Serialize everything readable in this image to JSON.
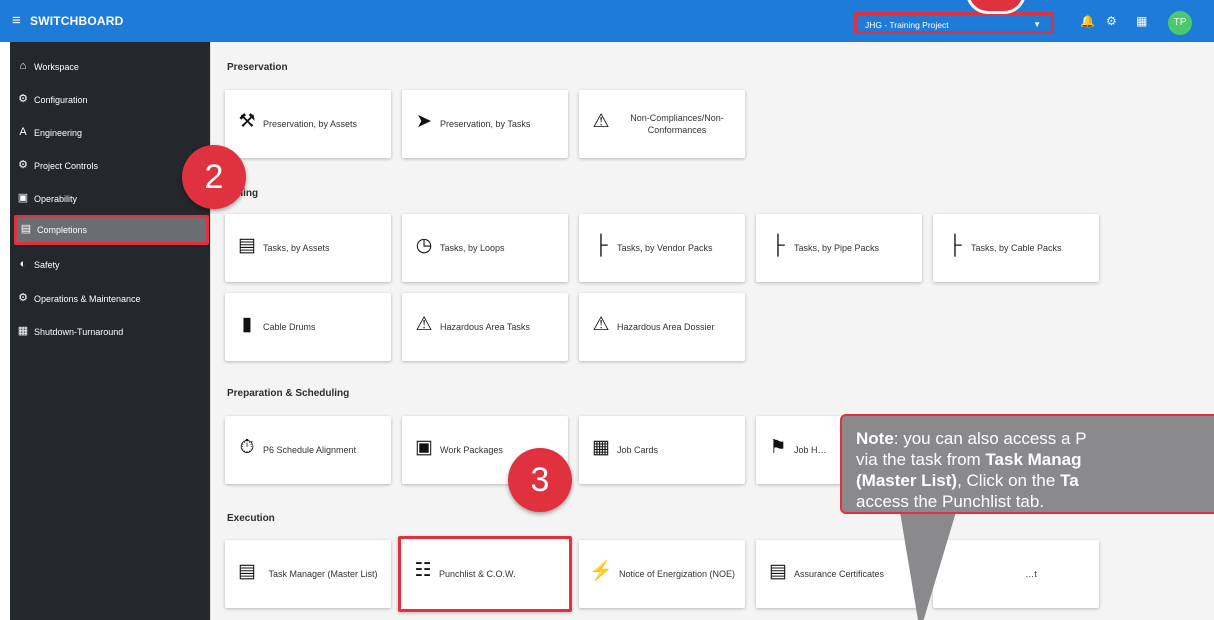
{
  "app": {
    "title": "SWITCHBOARD",
    "menu_icon": "hamburger-icon"
  },
  "topbar": {
    "project": "JHG - Training Project",
    "icons": [
      "bell-icon",
      "gear-icon",
      "grid-icon"
    ],
    "avatar": "TP"
  },
  "sidebar": {
    "items": [
      {
        "label": "Workspace",
        "icon": "home-icon"
      },
      {
        "label": "Configuration",
        "icon": "gear-icon"
      },
      {
        "label": "Engineering",
        "icon": "compass-icon"
      },
      {
        "label": "Project Controls",
        "icon": "controls-icon"
      },
      {
        "label": "Operability",
        "icon": "operability-icon"
      },
      {
        "label": "Completions",
        "icon": "completions-icon",
        "active": true
      },
      {
        "label": "Safety",
        "icon": "shield-icon"
      },
      {
        "label": "Operations & Maintenance",
        "icon": "worker-icon"
      },
      {
        "label": "Shutdown-Turnaround",
        "icon": "shutdown-icon"
      }
    ]
  },
  "sections": [
    {
      "title": "Preservation",
      "tiles": [
        "Preservation, by Assets",
        "Preservation, by Tasks",
        "Non-Compliances/Non-Conformances"
      ]
    },
    {
      "title": "…ning",
      "tiles": [
        "Tasks, by Assets",
        "Tasks, by Loops",
        "Tasks, by Vendor Packs",
        "Tasks, by Pipe Packs",
        "Tasks, by Cable Packs",
        "Cable Drums",
        "Hazardous Area Tasks",
        "Hazardous Area Dossier"
      ]
    },
    {
      "title": "Preparation & Scheduling",
      "tiles": [
        "P6 Schedule Alignment",
        "Work Packages",
        "Job Cards",
        "Job H…"
      ]
    },
    {
      "title": "Execution",
      "tiles": [
        "Task Manager (Master List)",
        "Punchlist & C.O.W.",
        "Notice of Energization (NOE)",
        "Assurance Certificates",
        "…t"
      ]
    }
  ],
  "annotations": {
    "step1": "",
    "step2": "2",
    "step3": "3",
    "note": {
      "prefix": "Note",
      "text1": ": you can also access a P",
      "text2": "via the task from ",
      "bold2": "Task Manag",
      "bold3": "(Master List)",
      "text3": ", Click on the ",
      "bold3b": "Ta",
      "text4": "access the Punchlist tab."
    }
  }
}
